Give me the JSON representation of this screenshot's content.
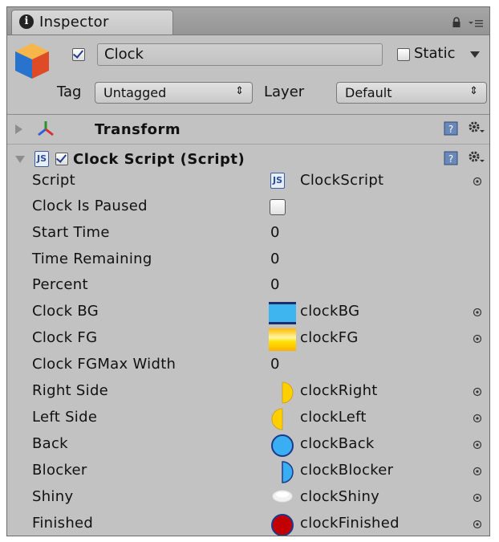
{
  "window": {
    "tab_label": "Inspector",
    "tab_icon": "info-icon",
    "controls": [
      "lock-icon",
      "menu-icon"
    ]
  },
  "object": {
    "active": true,
    "name": "Clock",
    "static_label": "Static",
    "static_checked": false,
    "tag_label": "Tag",
    "tag_value": "Untagged",
    "layer_label": "Layer",
    "layer_value": "Default"
  },
  "components": {
    "transform": {
      "title": "Transform",
      "expanded": false
    },
    "clock_script": {
      "title": "Clock Script (Script)",
      "expanded": true,
      "enabled": true
    }
  },
  "properties": [
    {
      "label": "Script",
      "type": "script",
      "value": "ClockScript"
    },
    {
      "label": "Clock Is Paused",
      "type": "bool",
      "value": false
    },
    {
      "label": "Start Time",
      "type": "number",
      "value": "0"
    },
    {
      "label": "Time Remaining",
      "type": "number",
      "value": "0"
    },
    {
      "label": "Percent",
      "type": "number",
      "value": "0"
    },
    {
      "label": "Clock BG",
      "type": "texture",
      "value": "clockBG",
      "thumb": "bg-thumb"
    },
    {
      "label": "Clock FG",
      "type": "texture",
      "value": "clockFG",
      "thumb": "fg-thumb"
    },
    {
      "label": "Clock FGMax Width",
      "type": "number",
      "value": "0"
    },
    {
      "label": "Right Side",
      "type": "texture",
      "value": "clockRight",
      "thumb": "right-half-thumb"
    },
    {
      "label": "Left Side",
      "type": "texture",
      "value": "clockLeft",
      "thumb": "left-half-thumb"
    },
    {
      "label": "Back",
      "type": "texture",
      "value": "clockBack",
      "thumb": "blue-circle-thumb"
    },
    {
      "label": "Blocker",
      "type": "texture",
      "value": "clockBlocker",
      "thumb": "blocker-thumb"
    },
    {
      "label": "Shiny",
      "type": "texture",
      "value": "clockShiny",
      "thumb": "shiny-thumb"
    },
    {
      "label": "Finished",
      "type": "texture",
      "value": "clockFinished",
      "thumb": "red-circle-thumb"
    }
  ],
  "colors": {
    "panel_bg": "#c2c2c2",
    "clock_bg_blue": "#3fb5f0",
    "clock_fg_yellow": "#ffd200",
    "back_blue": "#3aaef2",
    "finished_red": "#c30000"
  }
}
